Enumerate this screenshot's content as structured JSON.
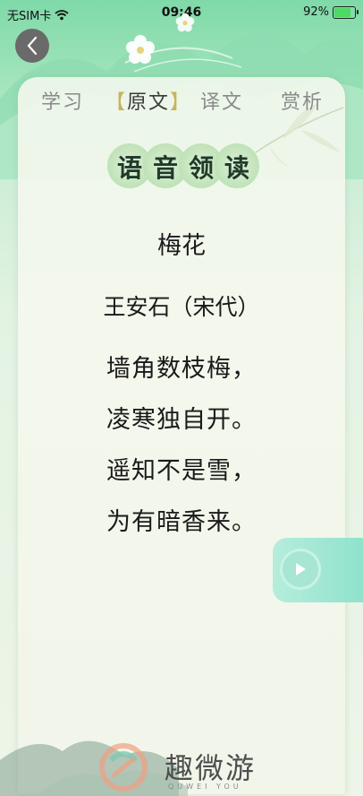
{
  "status_bar": {
    "carrier": "无SIM卡",
    "time": "09:46",
    "battery": "92%"
  },
  "tabs": [
    {
      "label": "学习"
    },
    {
      "label": "原文",
      "bracket_left": "【",
      "bracket_right": "】"
    },
    {
      "label": "译文"
    },
    {
      "label": "赏析"
    }
  ],
  "banner": {
    "chars": [
      "语",
      "音",
      "领",
      "读"
    ]
  },
  "poem": {
    "title": "梅花",
    "author": "王安石（宋代）",
    "lines": [
      "墙角数枝梅，",
      "凌寒独自开。",
      "遥知不是雪，",
      "为有暗香来。"
    ]
  },
  "watermark": {
    "text": "趣微游",
    "sub": "QUWEI YOU"
  },
  "colors": {
    "accent": "#c9b25a",
    "play": "#a6e6d2",
    "bg_green": "#a8e6c0"
  }
}
